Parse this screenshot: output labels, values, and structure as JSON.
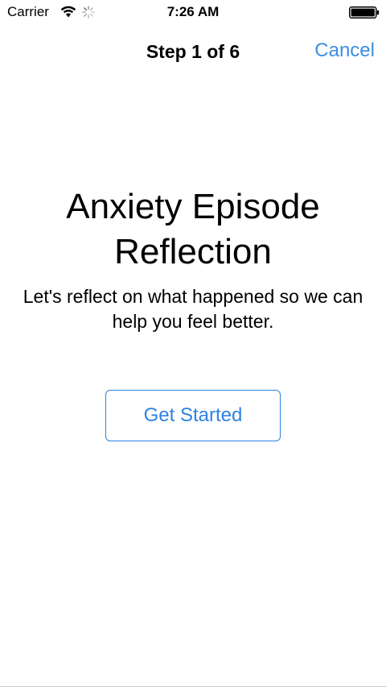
{
  "status_bar": {
    "carrier": "Carrier",
    "time": "7:26 AM",
    "wifi_icon": "wifi-icon",
    "activity_icon": "activity-spinner-icon",
    "battery_icon": "battery-icon"
  },
  "nav": {
    "title": "Step 1 of 6",
    "cancel_label": "Cancel"
  },
  "content": {
    "title": "Anxiety Episode Reflection",
    "description": "Let's reflect on what happened so we can help you feel better.",
    "get_started_label": "Get Started"
  },
  "colors": {
    "accent": "#2e82df",
    "nav_accent": "#3b8fe0",
    "text": "#000000",
    "background": "#ffffff"
  }
}
